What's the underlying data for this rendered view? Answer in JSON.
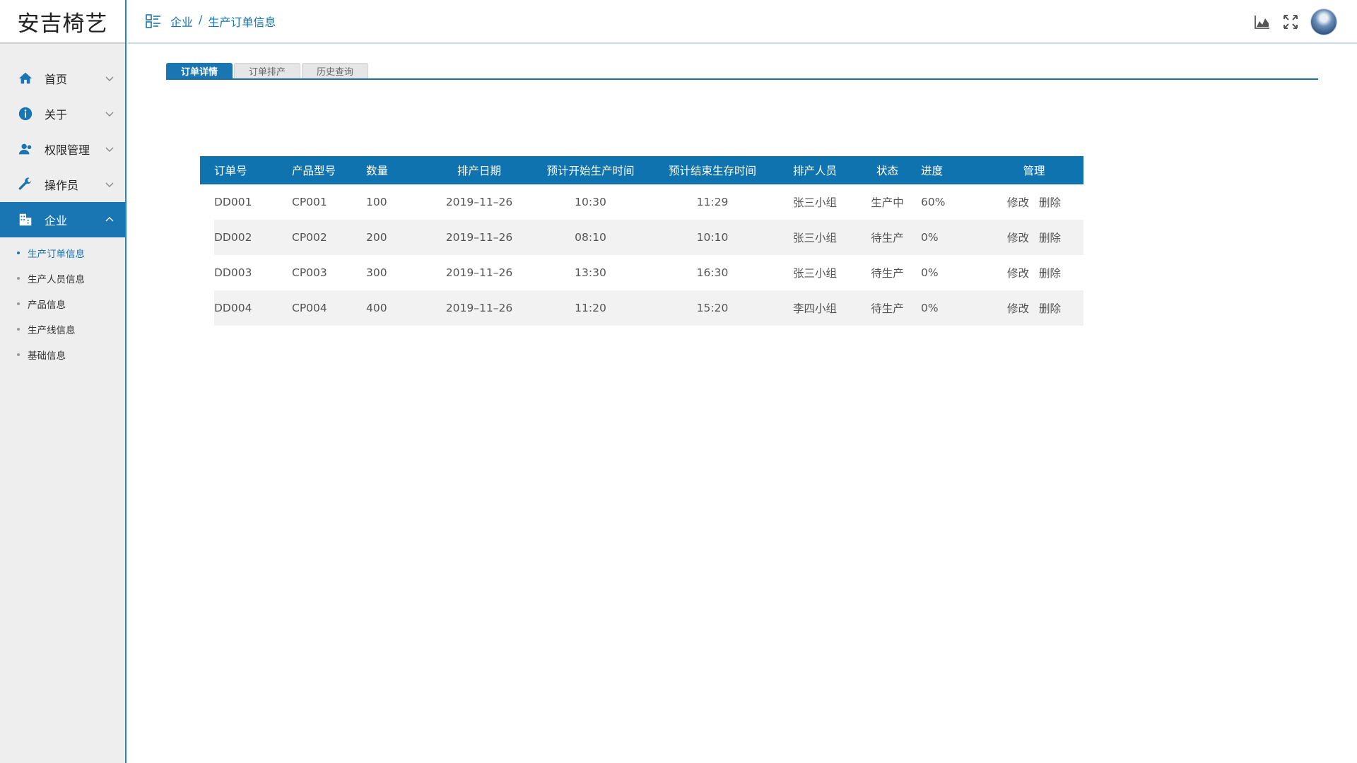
{
  "app": {
    "title": "安吉椅艺"
  },
  "sidebar": {
    "items": [
      {
        "label": "首页",
        "icon": "home-icon"
      },
      {
        "label": "关于",
        "icon": "info-icon"
      },
      {
        "label": "权限管理",
        "icon": "users-icon"
      },
      {
        "label": "操作员",
        "icon": "wrench-icon"
      },
      {
        "label": "企业",
        "icon": "building-icon"
      }
    ],
    "submenu": [
      {
        "label": "生产订单信息"
      },
      {
        "label": "生产人员信息"
      },
      {
        "label": "产品信息"
      },
      {
        "label": "生产线信息"
      },
      {
        "label": "基础信息"
      }
    ]
  },
  "header": {
    "breadcrumb": [
      "企业",
      "/",
      "生产订单信息"
    ]
  },
  "tabs": [
    "订单详情",
    "订单排产",
    "历史查询"
  ],
  "table": {
    "columns": [
      "订单号",
      "产品型号",
      "数量",
      "排产日期",
      "预计开始生产时间",
      "预计结束生存时间",
      "排产人员",
      "状态",
      "进度",
      "管理"
    ],
    "rows": [
      [
        "DD001",
        "CP001",
        "100",
        "2019–11–26",
        "10:30",
        "11:29",
        "张三小组",
        "生产中",
        "60%"
      ],
      [
        "DD002",
        "CP002",
        "200",
        "2019–11–26",
        "08:10",
        "10:10",
        "张三小组",
        "待生产",
        "0%"
      ],
      [
        "DD003",
        "CP003",
        "300",
        "2019–11–26",
        "13:30",
        "16:30",
        "张三小组",
        "待生产",
        "0%"
      ],
      [
        "DD004",
        "CP004",
        "400",
        "2019–11–26",
        "11:20",
        "15:20",
        "李四小组",
        "待生产",
        "0%"
      ]
    ],
    "actions": {
      "edit": "修改",
      "delete": "删除"
    }
  },
  "colors": {
    "accent": "#1a75b3",
    "header_bg": "#0f73b0",
    "sidebar_bg": "#eeeeee"
  }
}
